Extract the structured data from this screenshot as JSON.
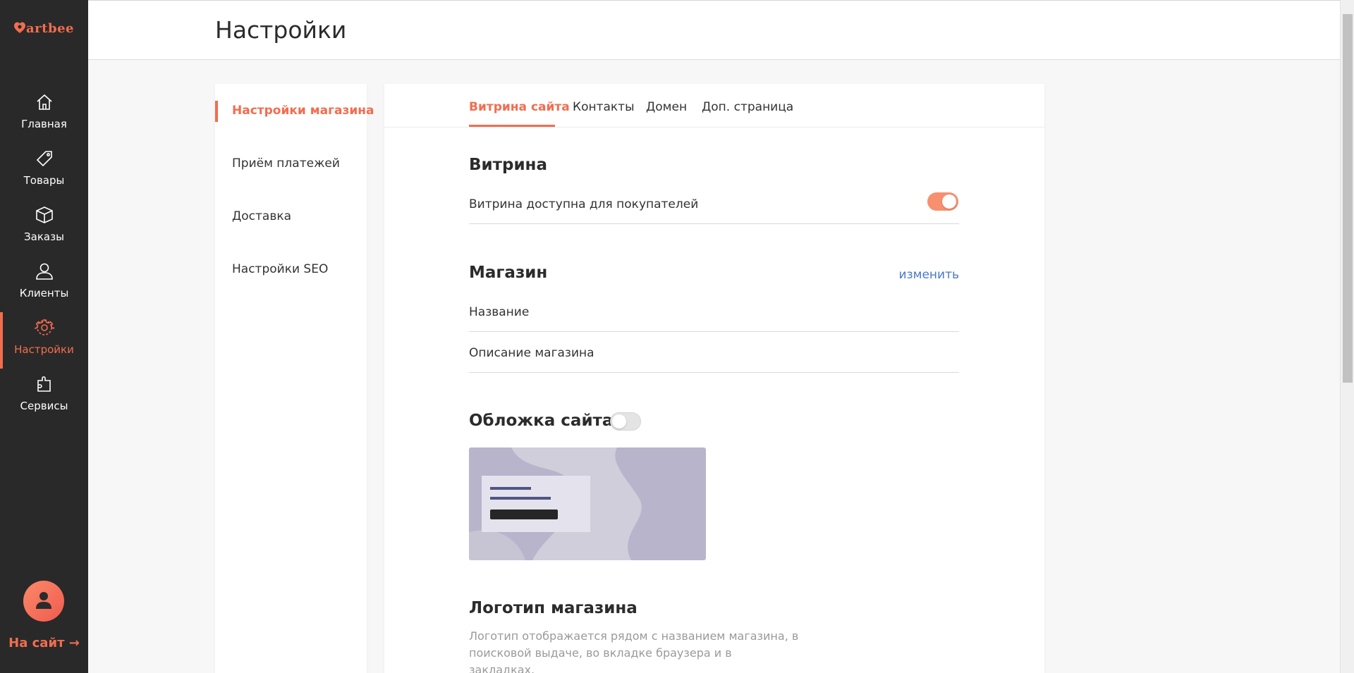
{
  "app": {
    "logo_text": "artbee",
    "brand_color": "#f26d4f"
  },
  "nav": {
    "items": [
      {
        "label": "Главная",
        "icon": "home-icon"
      },
      {
        "label": "Товары",
        "icon": "tag-icon"
      },
      {
        "label": "Заказы",
        "icon": "box-icon"
      },
      {
        "label": "Клиенты",
        "icon": "user-icon"
      },
      {
        "label": "Настройки",
        "icon": "gear-icon",
        "active": true
      },
      {
        "label": "Сервисы",
        "icon": "puzzle-icon"
      }
    ],
    "to_site": "На сайт →"
  },
  "header": {
    "title": "Настройки"
  },
  "submenu": {
    "items": [
      {
        "label": "Настройки магазина",
        "active": true
      },
      {
        "label": "Приём платежей"
      },
      {
        "label": "Доставка"
      },
      {
        "label": "Настройки SEO"
      }
    ]
  },
  "tabs": [
    {
      "label": "Витрина сайта",
      "active": true
    },
    {
      "label": "Контакты"
    },
    {
      "label": "Домен"
    },
    {
      "label": "Доп. страница"
    }
  ],
  "showcase": {
    "title": "Витрина",
    "available_label": "Витрина доступна для покупателей",
    "available_on": true
  },
  "shop": {
    "title": "Магазин",
    "edit_link": "изменить",
    "name_label": "Название",
    "description_label": "Описание магазина"
  },
  "cover": {
    "title": "Обложка сайта",
    "enabled": false
  },
  "logo_section": {
    "title": "Логотип магазина",
    "description_line1": "Логотип отображается рядом с названием магазина, в",
    "description_line2": "поисковой выдаче, во вкладке браузера и в закладках."
  }
}
